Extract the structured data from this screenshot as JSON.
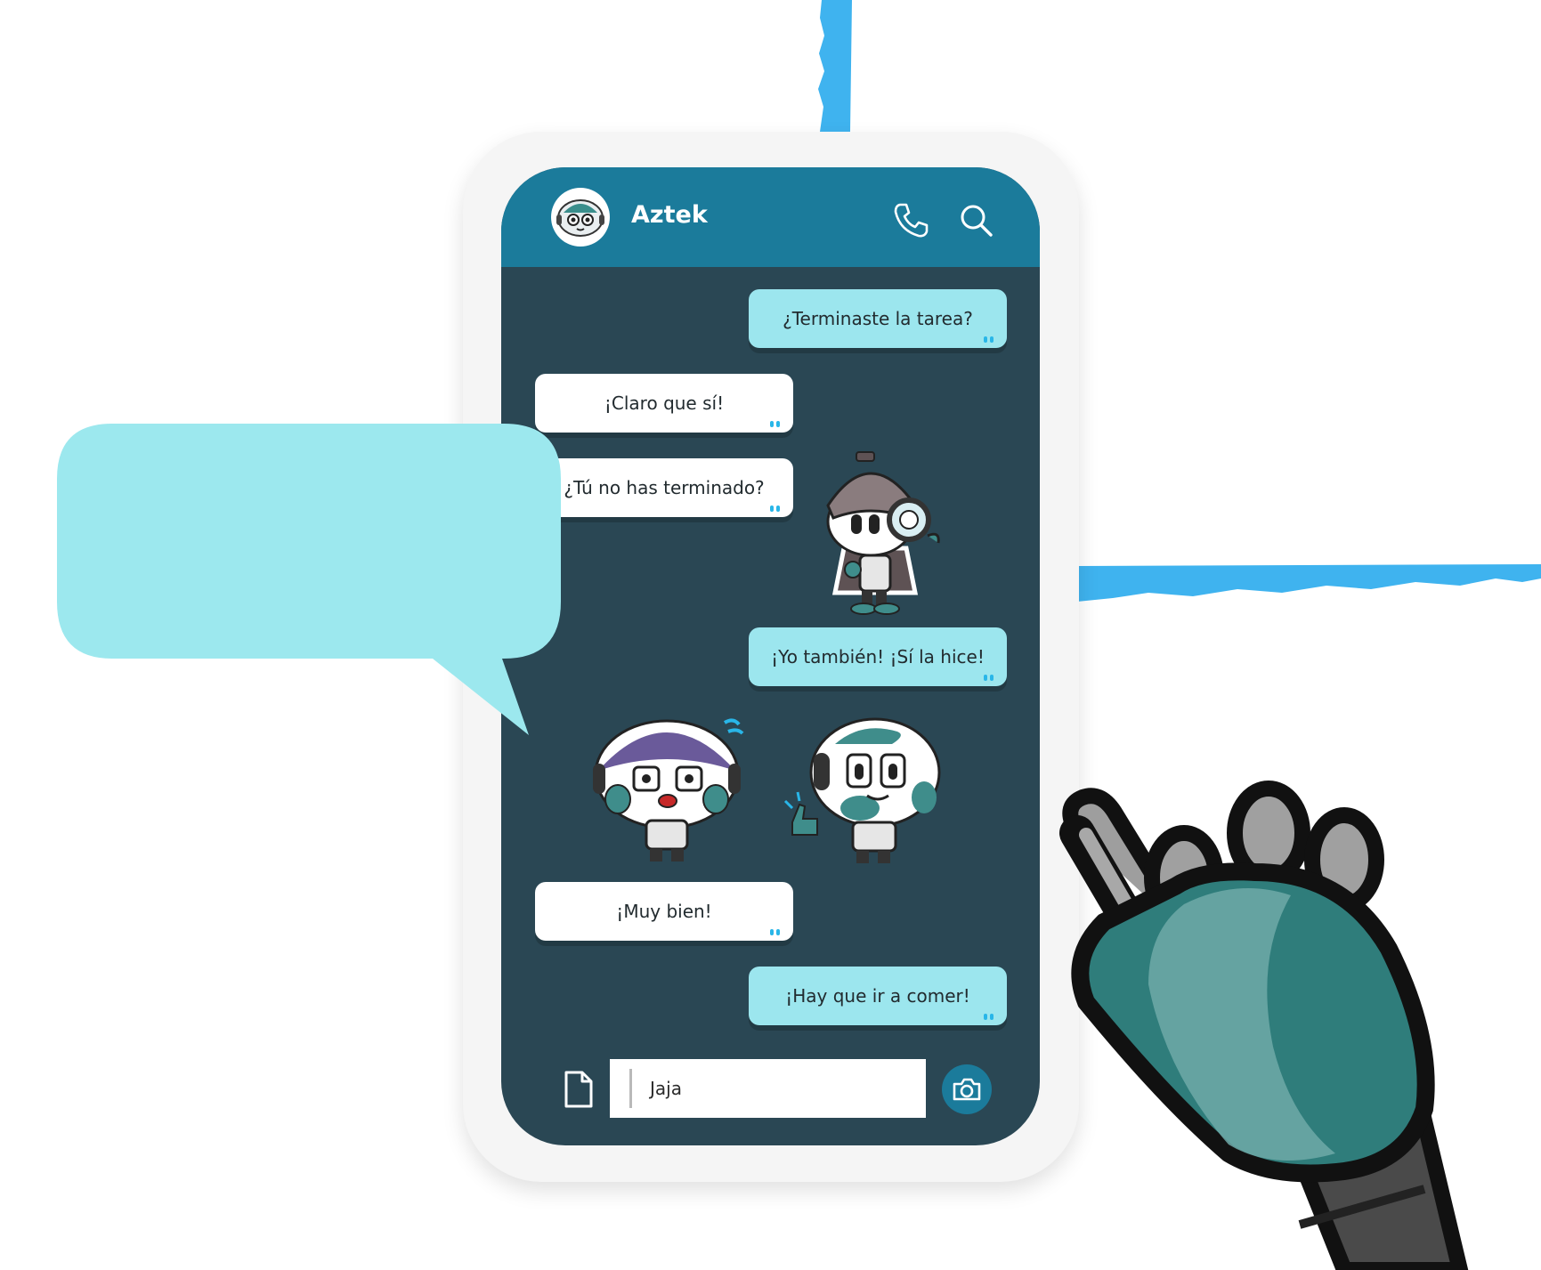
{
  "chat": {
    "contact_name": "Aztek",
    "messages": [
      {
        "type": "text",
        "direction": "sent",
        "text": "¿Terminaste la tarea?"
      },
      {
        "type": "text",
        "direction": "received",
        "text": "¡Claro que sí!"
      },
      {
        "type": "text",
        "direction": "received",
        "text": "¿Tú no has terminado?"
      },
      {
        "type": "sticker",
        "direction": "sent",
        "sticker": "detective-robot-sticker"
      },
      {
        "type": "text",
        "direction": "sent",
        "text": "¡Yo también! ¡Sí la hice!"
      },
      {
        "type": "sticker",
        "direction": "received",
        "sticker": "shocked-robot-sticker"
      },
      {
        "type": "sticker",
        "direction": "sent",
        "sticker": "thumbs-up-robot-sticker"
      },
      {
        "type": "text",
        "direction": "received",
        "text": "¡Muy bien!"
      },
      {
        "type": "text",
        "direction": "sent",
        "text": "¡Hay que ir a comer!"
      }
    ],
    "input": {
      "value": "Jaja"
    }
  },
  "icons": {
    "header": [
      "phone-icon",
      "search-icon"
    ],
    "composer": [
      "file-icon",
      "camera-icon"
    ],
    "read_receipt": "double-tick-icon"
  },
  "colors": {
    "header": "#1b7b9b",
    "chat_background": "#2a4754",
    "sent_bubble": "#9ce6ee",
    "received_bubble": "#ffffff",
    "tick": "#29b6e8",
    "speech_balloon": "#9ce8ee",
    "crayon": "#3fb3ef"
  }
}
